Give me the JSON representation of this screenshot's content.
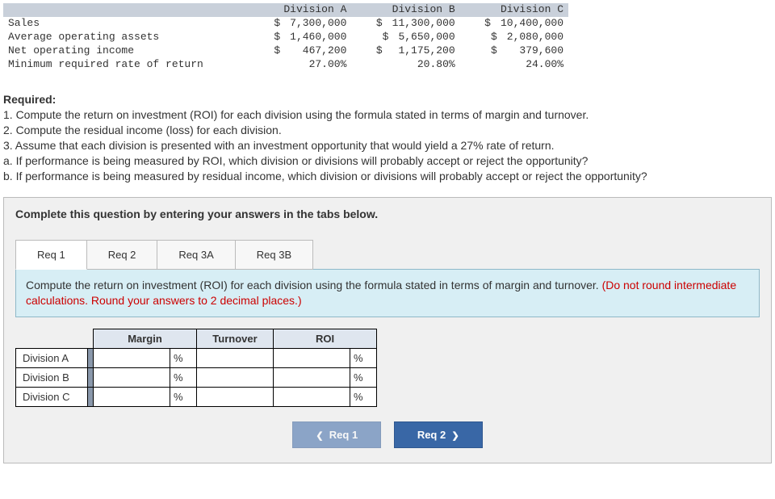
{
  "data_table": {
    "col_headers": [
      "Division A",
      "Division B",
      "Division C"
    ],
    "rows": [
      {
        "label": "Sales",
        "currency": "$",
        "vals": [
          "7,300,000",
          "11,300,000",
          "10,400,000"
        ]
      },
      {
        "label": "Average operating assets",
        "currency": "$",
        "vals": [
          "1,460,000",
          "5,650,000",
          "2,080,000"
        ]
      },
      {
        "label": "Net operating income",
        "currency": "$",
        "vals": [
          "467,200",
          "1,175,200",
          "379,600"
        ]
      },
      {
        "label": "Minimum required rate of return",
        "currency": "",
        "vals": [
          "27.00%",
          "20.80%",
          "24.00%"
        ]
      }
    ]
  },
  "required": {
    "heading": "Required:",
    "lines": [
      "1. Compute the return on investment (ROI) for each division using the formula stated in terms of margin and turnover.",
      "2. Compute the residual income (loss) for each division.",
      "3. Assume that each division is presented with an investment opportunity that would yield a 27% rate of return.",
      "a. If performance is being measured by ROI, which division or divisions will probably accept or reject the opportunity?",
      "b. If performance is being measured by residual income, which division or divisions will probably accept or reject the opportunity?"
    ]
  },
  "complete_msg": "Complete this question by entering your answers in the tabs below.",
  "tabs": [
    {
      "label": "Req 1",
      "active": true
    },
    {
      "label": "Req 2",
      "active": false
    },
    {
      "label": "Req 3A",
      "active": false
    },
    {
      "label": "Req 3B",
      "active": false
    }
  ],
  "instruction": {
    "black": "Compute the return on investment (ROI) for each division using the formula stated in terms of margin and turnover. ",
    "red": "(Do not round intermediate calculations. Round your answers to 2 decimal places.)"
  },
  "answer": {
    "cols": [
      "Margin",
      "Turnover",
      "ROI"
    ],
    "row_labels": [
      "Division A",
      "Division B",
      "Division C"
    ],
    "pct_unit": "%"
  },
  "nav": {
    "prev": "Req 1",
    "next": "Req 2"
  }
}
